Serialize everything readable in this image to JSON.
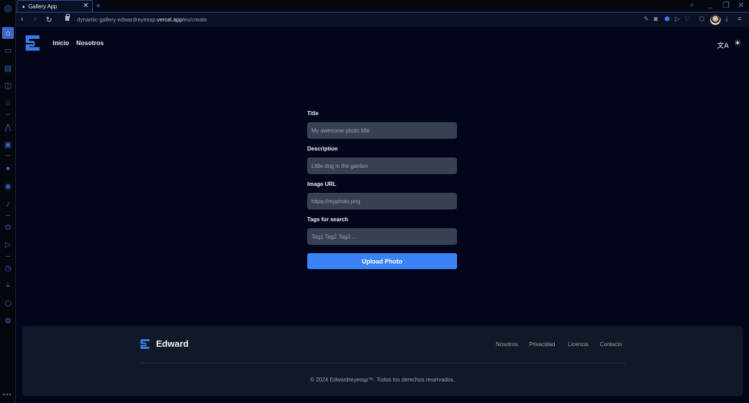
{
  "browser": {
    "tab_title": "Gallery App",
    "new_tab_label": "+",
    "url_prefix": "dynamic-gallery-edwardreyessp.",
    "url_domain": "vercel.app",
    "url_path": "/es/create",
    "sidebar_icons": [
      "home-icon",
      "gamepad-icon",
      "briefcase-icon",
      "book-icon",
      "pinboard-icon",
      "aria-icon",
      "app-icon",
      "messenger-icon",
      "whatsapp-icon",
      "tiktok-icon",
      "player-icon",
      "send-icon",
      "history-icon",
      "downloads-icon",
      "extensions-icon",
      "settings-icon"
    ],
    "toolbar_icons": [
      "edit-icon",
      "camera-icon",
      "shield-icon",
      "send-icon",
      "heart-icon",
      "cube-icon",
      "avatar",
      "download-icon",
      "menu-icon"
    ],
    "window_controls": [
      "search-icon",
      "minimize-icon",
      "restore-icon",
      "close-icon"
    ]
  },
  "header": {
    "nav": [
      {
        "label": "Inicio"
      },
      {
        "label": "Nosotros"
      }
    ],
    "translate_icon": "文A",
    "theme_icon": "☀"
  },
  "form": {
    "fields": [
      {
        "label": "Title",
        "placeholder": "My awesome photo title",
        "value": ""
      },
      {
        "label": "Description",
        "placeholder": "Little dog in the garden",
        "value": ""
      },
      {
        "label": "Image URL",
        "placeholder": "https://myphoto.png",
        "value": ""
      },
      {
        "label": "Tags for search",
        "placeholder": "Tag1 Tag2 Tag3 ...",
        "value": ""
      }
    ],
    "submit_label": "Upload Photo"
  },
  "footer": {
    "brand": "Edward",
    "links": [
      {
        "label": "Nosotros"
      },
      {
        "label": "Privacidad"
      },
      {
        "label": "Licencia"
      },
      {
        "label": "Contacto"
      }
    ],
    "copyright": "© 2024 Edwardreyessp™. Todos los derechos reservados."
  },
  "colors": {
    "accent": "#3b82f6",
    "background": "#03061a",
    "input_bg": "#374151",
    "footer_bg": "#111827"
  }
}
